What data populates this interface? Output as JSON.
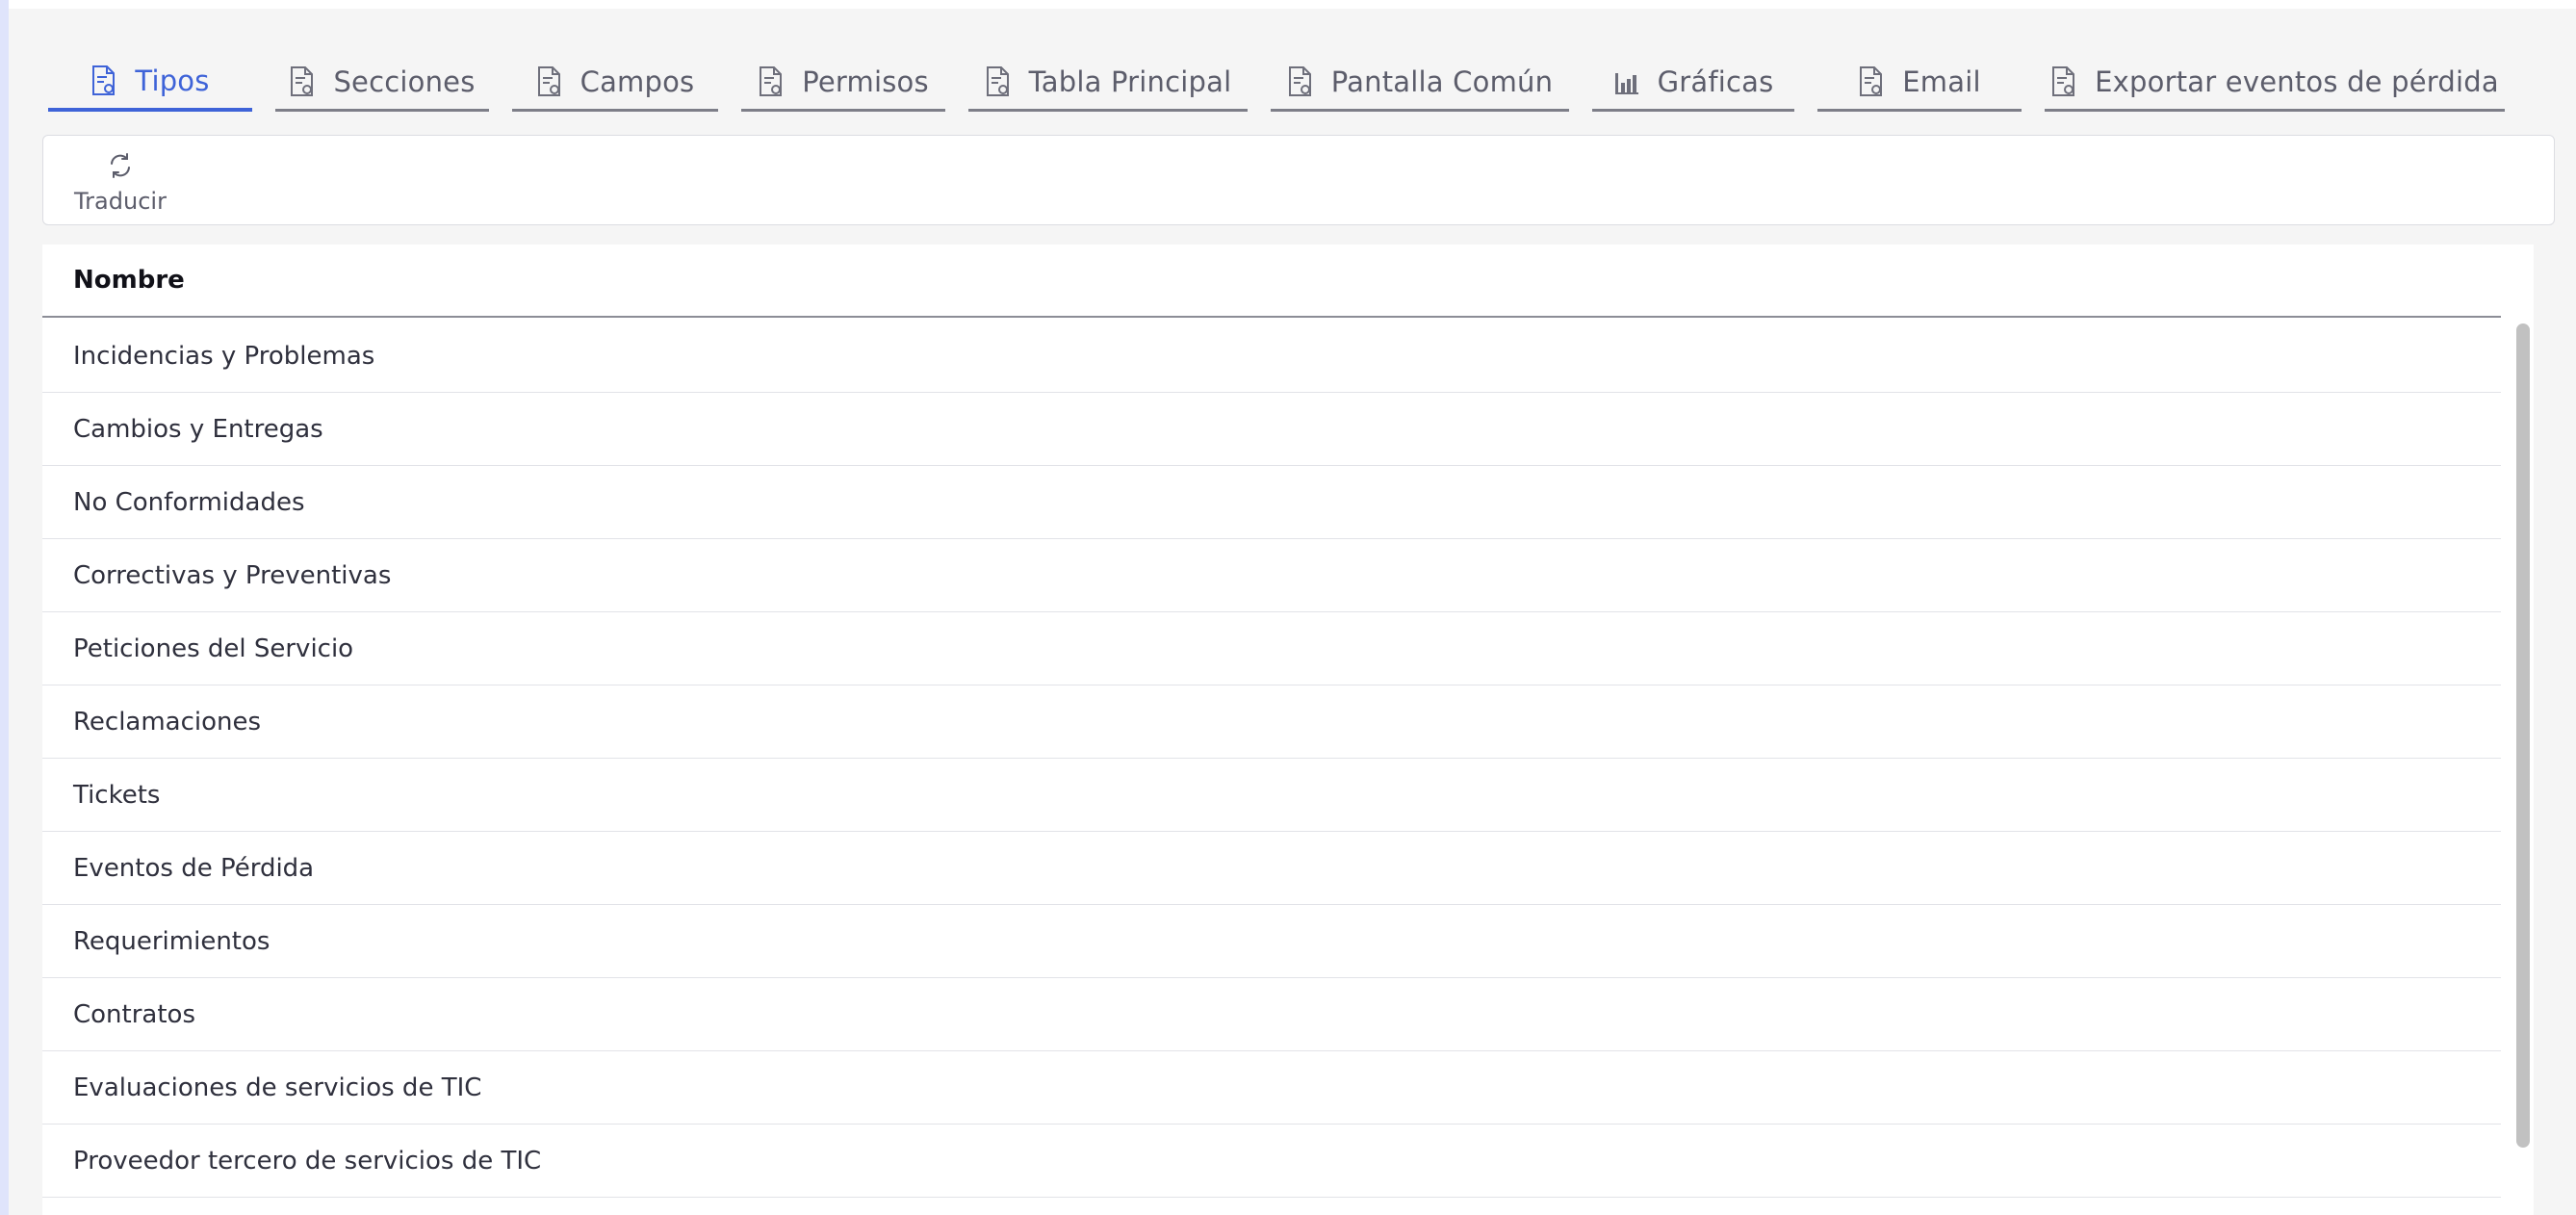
{
  "tabs": [
    {
      "label": "Tipos",
      "icon": "document-gear-icon",
      "active": true
    },
    {
      "label": "Secciones",
      "icon": "document-gear-icon"
    },
    {
      "label": "Campos",
      "icon": "document-gear-icon"
    },
    {
      "label": "Permisos",
      "icon": "document-gear-icon"
    },
    {
      "label": "Tabla Principal",
      "icon": "document-gear-icon"
    },
    {
      "label": "Pantalla Común",
      "icon": "document-gear-icon"
    },
    {
      "label": "Gráficas",
      "icon": "bar-chart-icon"
    },
    {
      "label": "Email",
      "icon": "document-gear-icon"
    },
    {
      "label": "Exportar eventos de pérdida",
      "icon": "document-gear-icon"
    }
  ],
  "toolbar": {
    "translate_label": "Traducir",
    "translate_icon": "refresh-icon"
  },
  "table": {
    "header": "Nombre",
    "rows": [
      "Incidencias y Problemas",
      "Cambios y Entregas",
      "No Conformidades",
      "Correctivas y Preventivas",
      "Peticiones del Servicio",
      "Reclamaciones",
      "Tickets",
      "Eventos de Pérdida",
      "Requerimientos",
      "Contratos",
      "Evaluaciones de servicios de TIC",
      "Proveedor tercero de servicios de TIC"
    ]
  },
  "colors": {
    "accent": "#3e63d8",
    "tab_text": "#5c5d6b",
    "background": "#f5f5f5"
  }
}
